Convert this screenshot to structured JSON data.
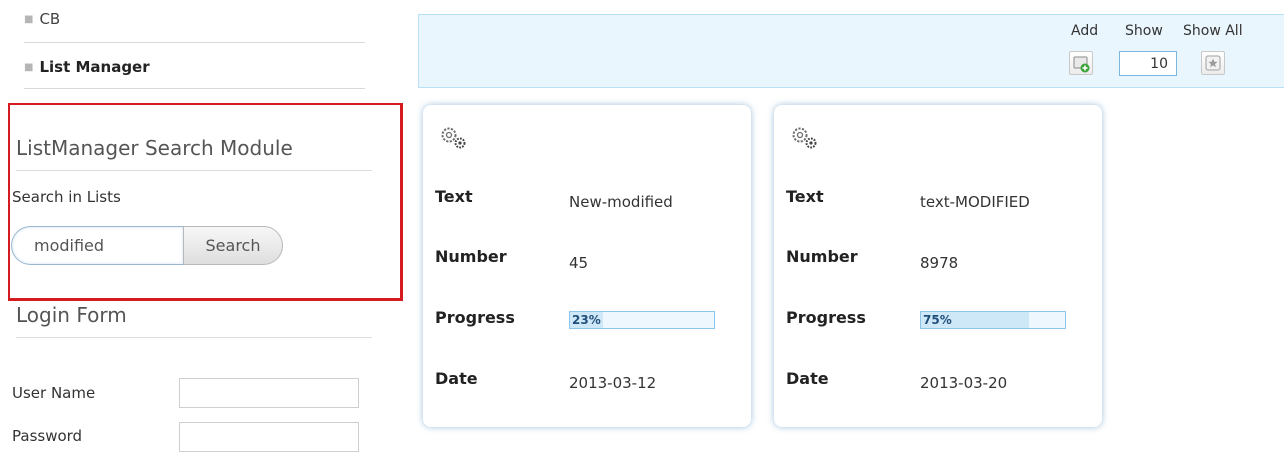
{
  "sidebar": {
    "nav": [
      "CB",
      "List Manager"
    ],
    "search_module": {
      "title": "ListManager Search Module",
      "label": "Search in Lists",
      "input_value": "modified",
      "button_label": "Search"
    },
    "login": {
      "title": "Login Form",
      "username_label": "User Name",
      "password_label": "Password"
    }
  },
  "toolbar": {
    "add_label": "Add",
    "show_label": "Show",
    "show_value": "10",
    "show_all_label": "Show All"
  },
  "cards": [
    {
      "text_label": "Text",
      "text_value": "New-modified",
      "number_label": "Number",
      "number_value": "45",
      "progress_label": "Progress",
      "progress_text": "23%",
      "progress_value": 23,
      "date_label": "Date",
      "date_value": "2013-03-12"
    },
    {
      "text_label": "Text",
      "text_value": "text-MODIFIED",
      "number_label": "Number",
      "number_value": "8978",
      "progress_label": "Progress",
      "progress_text": "75%",
      "progress_value": 75,
      "date_label": "Date",
      "date_value": "2013-03-20"
    }
  ],
  "colors": {
    "highlight_frame": "#d31b20",
    "toolbar_bg": "#eaf6fd",
    "progress_fill": "#cfe8f8"
  },
  "icons": {
    "card": "gears-icon",
    "add": "add-item-icon",
    "show_all": "star-icon"
  }
}
